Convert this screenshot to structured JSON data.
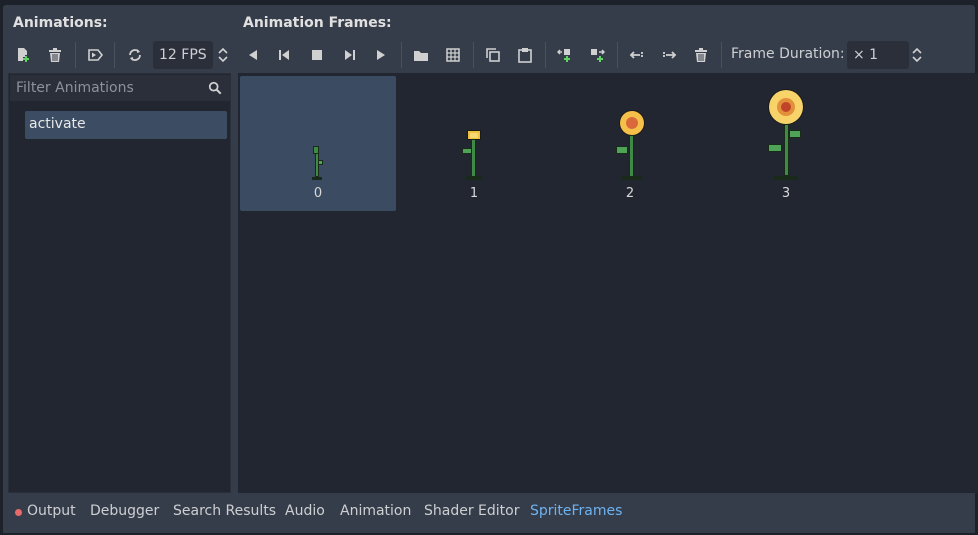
{
  "header": {
    "animations_title": "Animations:",
    "frames_title": "Animation Frames:"
  },
  "toolbar": {
    "fps_value": "12 FPS",
    "frame_duration_label": "Frame Duration:",
    "frame_duration_value": "× 1"
  },
  "animations": {
    "filter_placeholder": "Filter Animations",
    "items": [
      {
        "label": "activate"
      }
    ]
  },
  "frames": [
    {
      "label": "0"
    },
    {
      "label": "1"
    },
    {
      "label": "2"
    },
    {
      "label": "3"
    }
  ],
  "bottom_tabs": [
    {
      "label": "Output"
    },
    {
      "label": "Debugger"
    },
    {
      "label": "Search Results"
    },
    {
      "label": "Audio"
    },
    {
      "label": "Animation"
    },
    {
      "label": "Shader Editor"
    },
    {
      "label": "SpriteFrames"
    }
  ],
  "colors": {
    "accent": "#6db3f2",
    "selected": "#3a4b62",
    "icon_green": "#5fd35f",
    "output_dot": "#e86a6a"
  }
}
